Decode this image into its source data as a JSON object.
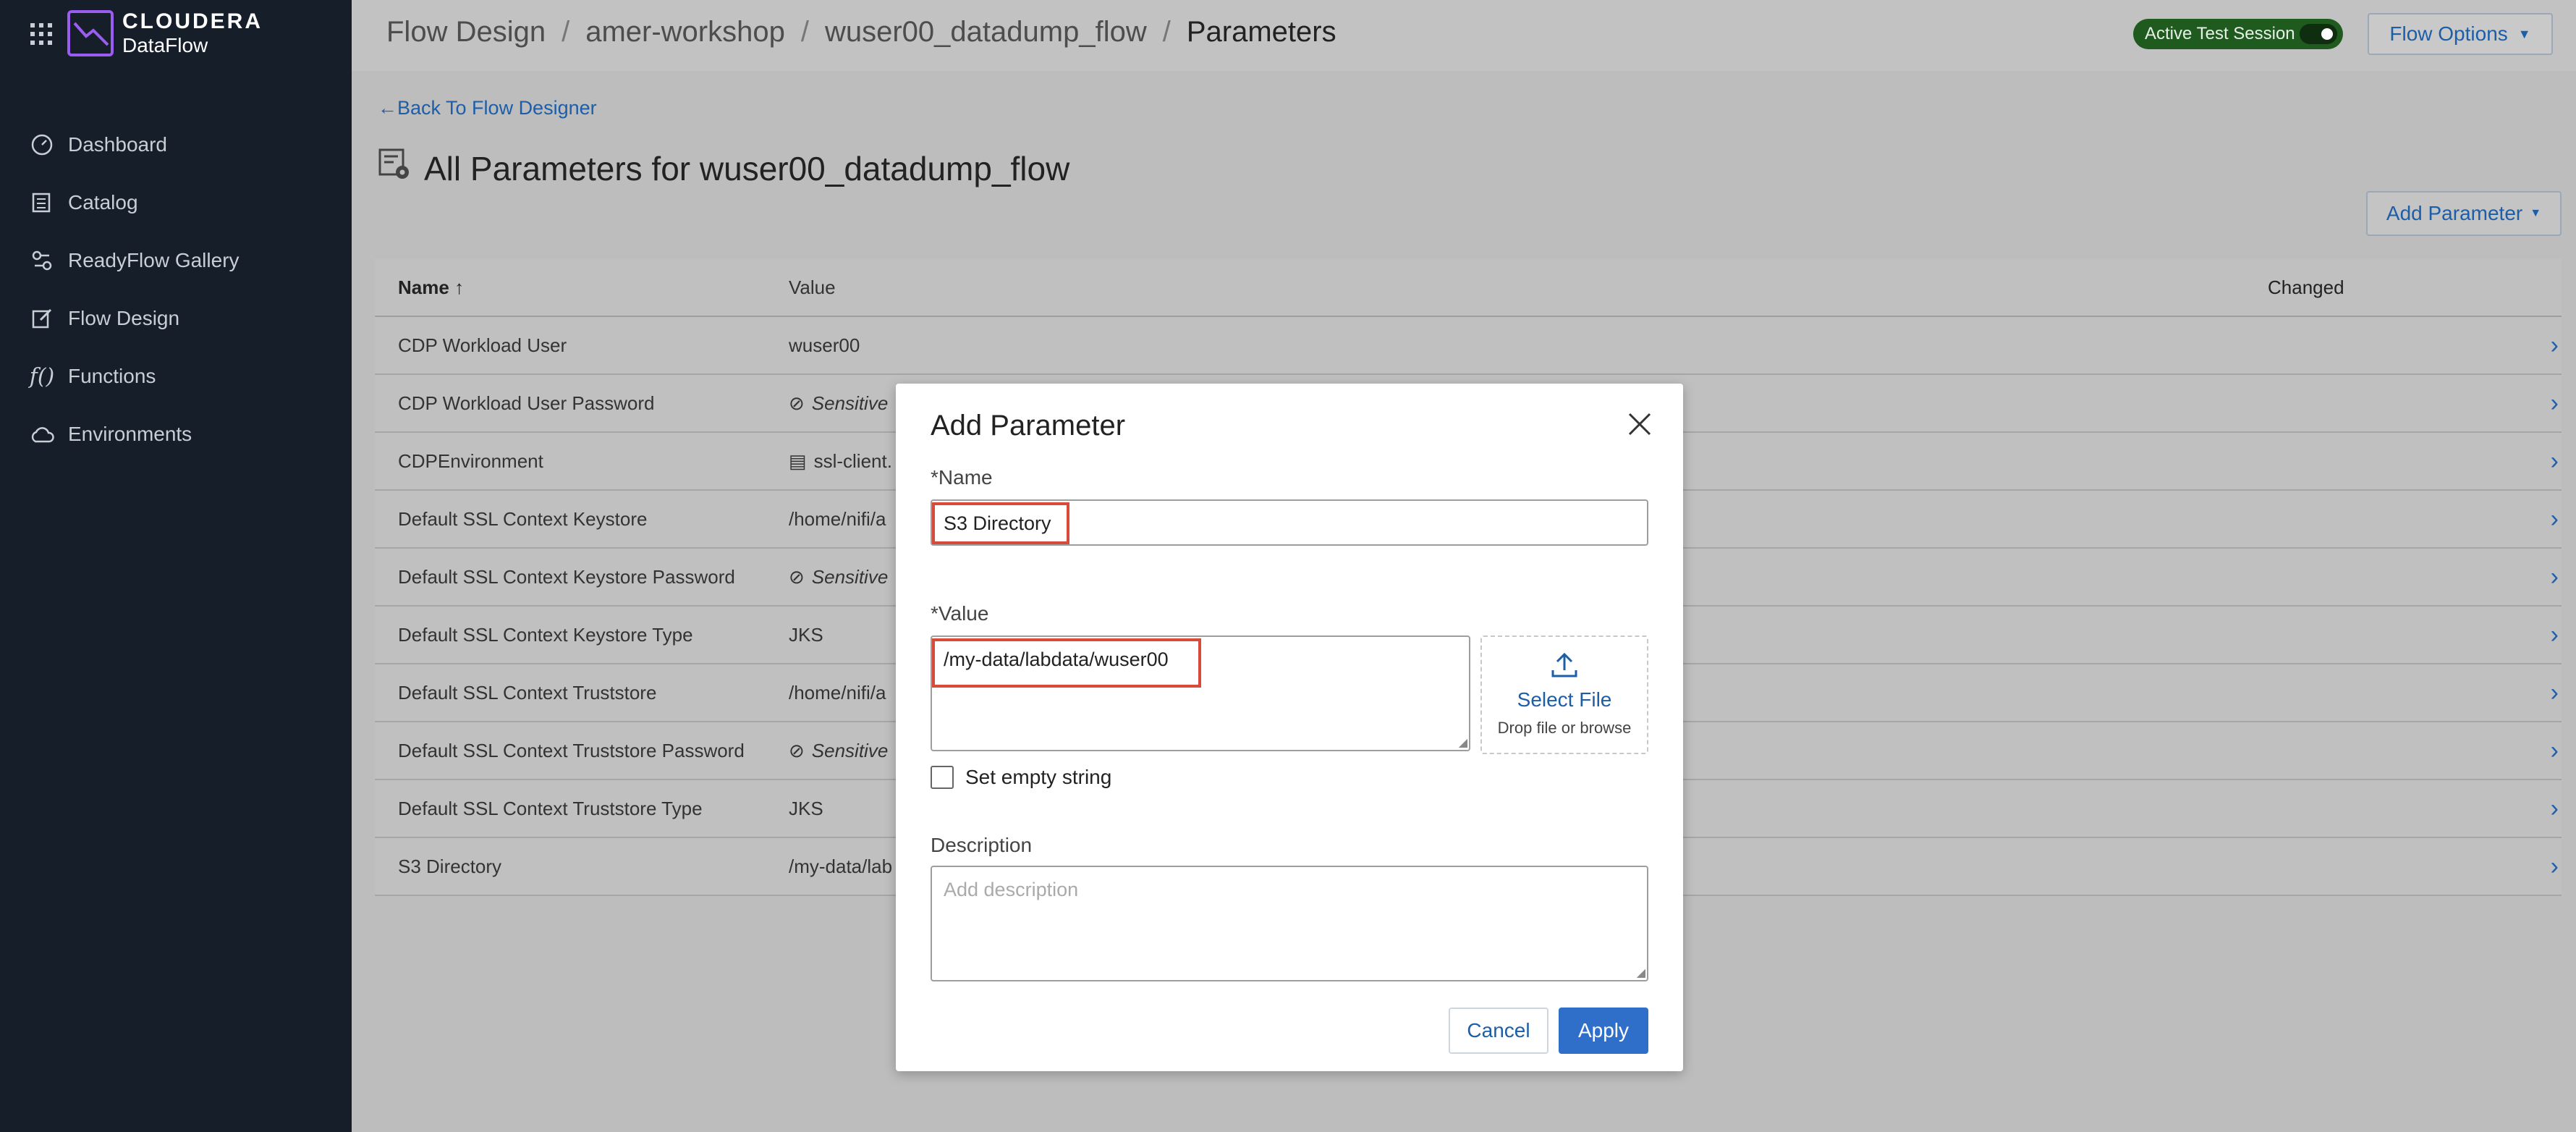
{
  "app": {
    "brand_line1": "CLOUDERA",
    "brand_line2": "DataFlow"
  },
  "sidebar": {
    "items": [
      {
        "label": "Dashboard",
        "icon": "gauge-icon"
      },
      {
        "label": "Catalog",
        "icon": "catalog-icon"
      },
      {
        "label": "ReadyFlow Gallery",
        "icon": "readyflow-icon"
      },
      {
        "label": "Flow Design",
        "icon": "edit-icon"
      },
      {
        "label": "Functions",
        "icon": "function-icon"
      },
      {
        "label": "Environments",
        "icon": "cloud-icon"
      }
    ]
  },
  "header": {
    "breadcrumb": [
      "Flow Design",
      "amer-workshop",
      "wuser00_datadump_flow",
      "Parameters"
    ],
    "separator": "/",
    "test_session_label": "Active Test Session",
    "flow_options_label": "Flow Options"
  },
  "main": {
    "back_link": "Back To Flow Designer",
    "title": "All Parameters for wuser00_datadump_flow",
    "add_parameter_label": "Add Parameter",
    "table": {
      "columns": {
        "name": "Name",
        "value": "Value",
        "changed": "Changed"
      },
      "rows": [
        {
          "name": "CDP Workload User",
          "value": "wuser00"
        },
        {
          "name": "CDP Workload User Password",
          "value": "Sensitive"
        },
        {
          "name": "CDPEnvironment",
          "value": "ssl-client."
        },
        {
          "name": "Default SSL Context Keystore",
          "value": "/home/nifi/a"
        },
        {
          "name": "Default SSL Context Keystore Password",
          "value": "Sensitive"
        },
        {
          "name": "Default SSL Context Keystore Type",
          "value": "JKS"
        },
        {
          "name": "Default SSL Context Truststore",
          "value": "/home/nifi/a"
        },
        {
          "name": "Default SSL Context Truststore Password",
          "value": "Sensitive"
        },
        {
          "name": "Default SSL Context Truststore Type",
          "value": "JKS"
        },
        {
          "name": "S3 Directory",
          "value": "/my-data/lab"
        }
      ]
    }
  },
  "modal": {
    "title": "Add Parameter",
    "name_label": "*Name",
    "name_value": "S3 Directory",
    "value_label": "*Value",
    "value_text": "/my-data/labdata/wuser00",
    "select_file_label": "Select File",
    "select_file_hint": "Drop file or browse",
    "empty_string_label": "Set empty string",
    "description_label": "Description",
    "description_placeholder": "Add description",
    "cancel_label": "Cancel",
    "apply_label": "Apply"
  },
  "colors": {
    "accent": "#2f6fca",
    "link": "#1d5ea8",
    "highlight": "#d84a3a",
    "sidebar": "#151e29",
    "brand": "#9b5cf2"
  }
}
